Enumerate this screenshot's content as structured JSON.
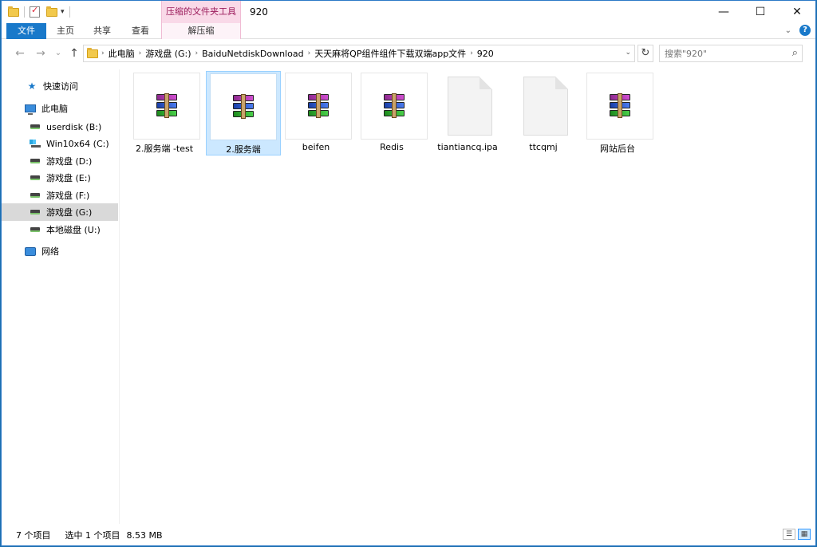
{
  "window": {
    "title": "920",
    "context_tab_header": "压缩的文件夹工具",
    "controls": {
      "minimize": "—",
      "maximize": "☐",
      "close": "✕"
    }
  },
  "ribbon": {
    "tabs": [
      {
        "label": "文件"
      },
      {
        "label": "主页"
      },
      {
        "label": "共享"
      },
      {
        "label": "查看"
      },
      {
        "label": "解压缩"
      }
    ]
  },
  "nav": {
    "back": "←",
    "forward": "→",
    "recent": "⌄",
    "up": "↑",
    "breadcrumb": [
      "此电脑",
      "游戏盘 (G:)",
      "BaiduNetdiskDownload",
      "天天麻将QP组件组件下载双端app文件",
      "920"
    ],
    "search_placeholder": "搜索\"920\""
  },
  "sidebar": {
    "items": [
      {
        "label": "快速访问",
        "icon": "star-icon"
      },
      {
        "label": "此电脑",
        "icon": "computer-icon"
      },
      {
        "label": "userdisk (B:)",
        "icon": "drive-icon"
      },
      {
        "label": "Win10x64 (C:)",
        "icon": "windows-drive-icon"
      },
      {
        "label": "游戏盘 (D:)",
        "icon": "drive-icon"
      },
      {
        "label": "游戏盘 (E:)",
        "icon": "drive-icon"
      },
      {
        "label": "游戏盘 (F:)",
        "icon": "drive-icon"
      },
      {
        "label": "游戏盘 (G:)",
        "icon": "drive-icon",
        "selected": true
      },
      {
        "label": "本地磁盘 (U:)",
        "icon": "drive-icon"
      },
      {
        "label": "网络",
        "icon": "network-icon"
      }
    ]
  },
  "files": [
    {
      "name": "2.服务端 -test",
      "icon": "rar-archive-icon"
    },
    {
      "name": "2.服务端",
      "icon": "rar-archive-icon",
      "selected": true
    },
    {
      "name": "beifen",
      "icon": "rar-archive-icon"
    },
    {
      "name": "Redis",
      "icon": "rar-archive-icon"
    },
    {
      "name": "tiantiancq.ipa",
      "icon": "generic-file-icon"
    },
    {
      "name": "ttcqmj",
      "icon": "generic-file-icon"
    },
    {
      "name": "网站后台",
      "icon": "rar-archive-icon"
    }
  ],
  "status": {
    "item_count": "7 个项目",
    "selection": "选中 1 个项目",
    "size": "8.53 MB"
  },
  "colors": {
    "accent": "#1979ca",
    "selection_bg": "#cce8ff",
    "context_tab": "#f9d9e8"
  }
}
